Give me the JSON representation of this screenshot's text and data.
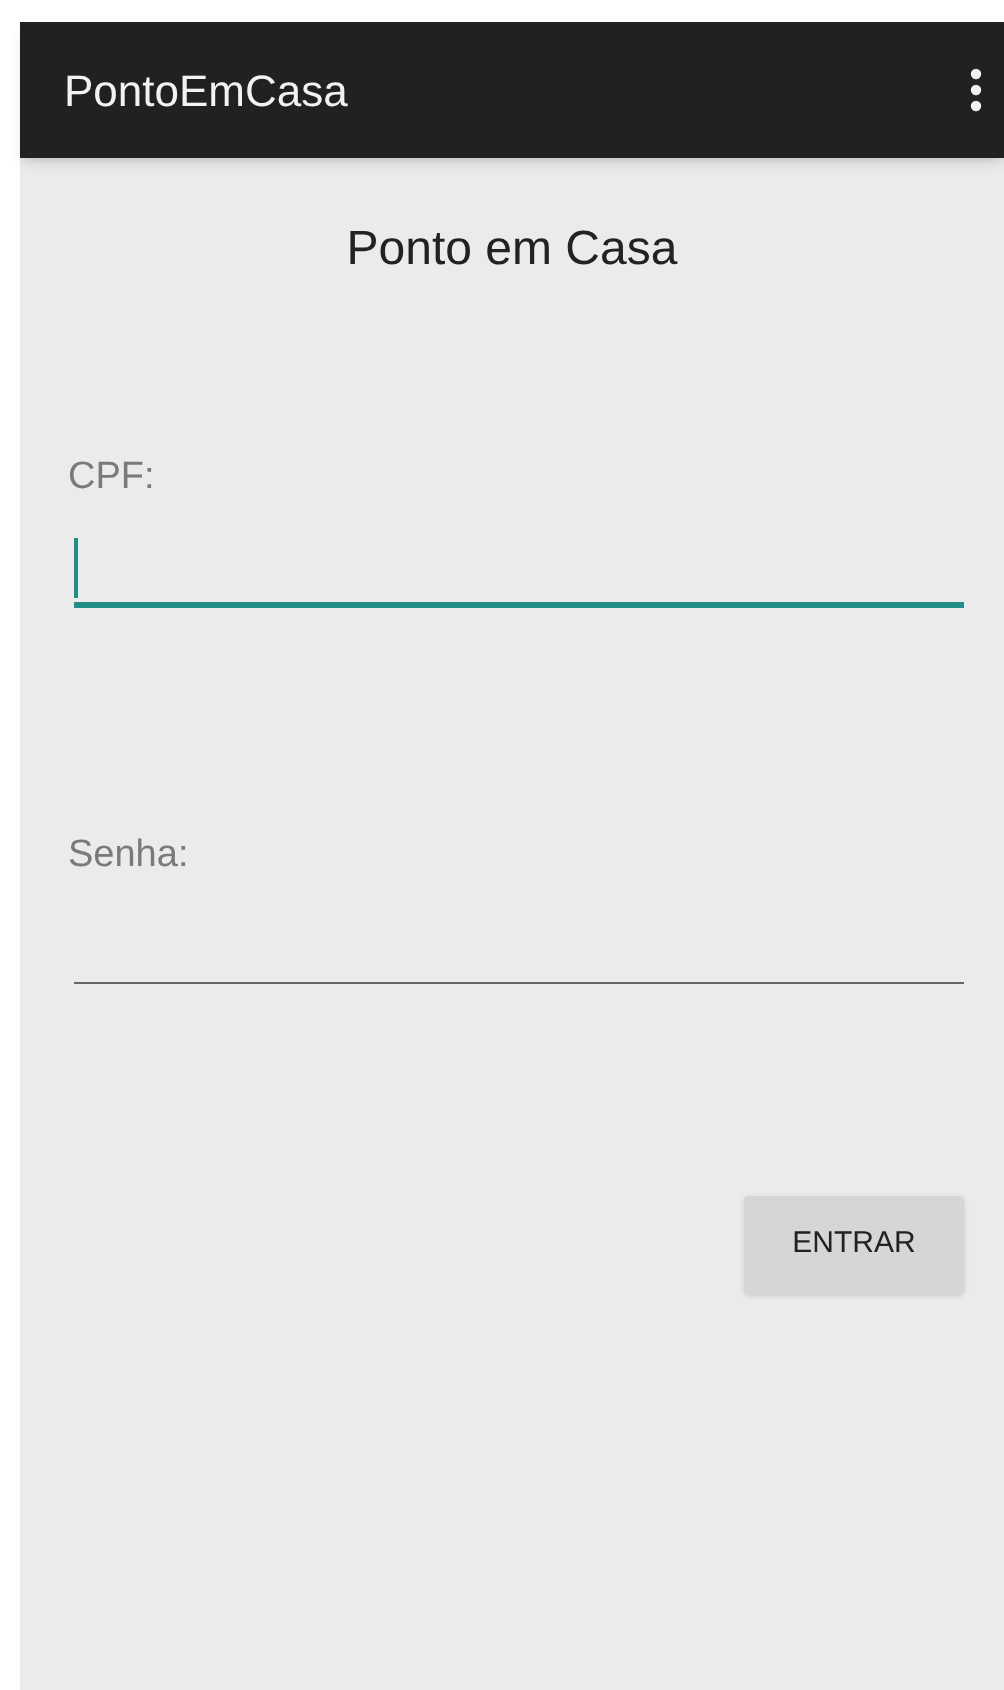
{
  "app_bar": {
    "title": "PontoEmCasa"
  },
  "heading": "Ponto em Casa",
  "fields": [
    {
      "label": "CPF:",
      "focused": true
    },
    {
      "label": "Senha:",
      "focused": false
    }
  ],
  "button": {
    "label": "ENTRAR"
  }
}
